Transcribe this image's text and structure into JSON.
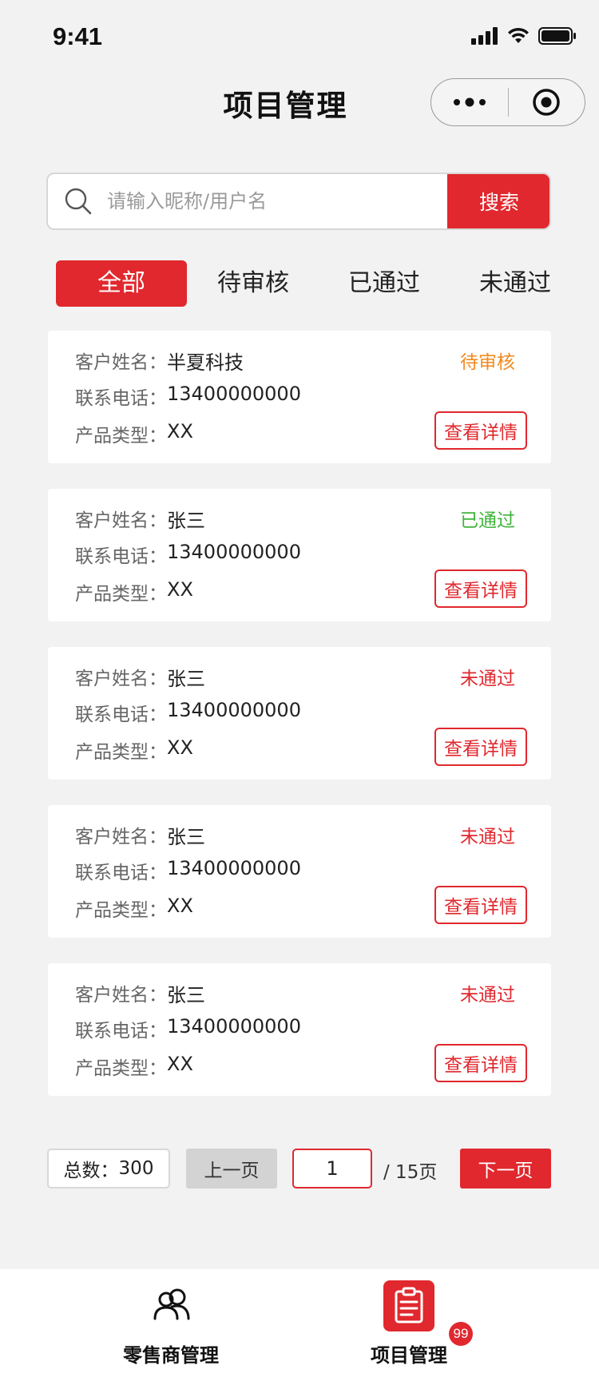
{
  "status_bar": {
    "time": "9:41"
  },
  "nav": {
    "title": "项目管理"
  },
  "search": {
    "placeholder": "请输入昵称/用户名",
    "value": "",
    "button_label": "搜索"
  },
  "tabs": [
    {
      "label": "全部",
      "active": true
    },
    {
      "label": "待审核",
      "active": false
    },
    {
      "label": "已通过",
      "active": false
    },
    {
      "label": "未通过",
      "active": false
    }
  ],
  "field_labels": {
    "name": "客户姓名：",
    "phone": "联系电话：",
    "type": "产品类型："
  },
  "detail_label": "查看详情",
  "records": [
    {
      "name": "半夏科技",
      "phone": "13400000000",
      "type": "XX",
      "status": "待审核",
      "status_color": "#f28a20"
    },
    {
      "name": "张三",
      "phone": "13400000000",
      "type": "XX",
      "status": "已通过",
      "status_color": "#3fb43a"
    },
    {
      "name": "张三",
      "phone": "13400000000",
      "type": "XX",
      "status": "未通过",
      "status_color": "#e0282e"
    },
    {
      "name": "张三",
      "phone": "13400000000",
      "type": "XX",
      "status": "未通过",
      "status_color": "#e0282e"
    },
    {
      "name": "张三",
      "phone": "13400000000",
      "type": "XX",
      "status": "未通过",
      "status_color": "#e0282e"
    }
  ],
  "pagination": {
    "total_label": "总数：",
    "total": "300",
    "prev_label": "上一页",
    "current_page": "1",
    "page_total": "/ 15页",
    "next_label": "下一页"
  },
  "tabbar": {
    "items": [
      {
        "label": "零售商管理",
        "icon": "users-icon",
        "active": false
      },
      {
        "label": "项目管理",
        "icon": "clipboard-icon",
        "active": true
      }
    ],
    "badge_count": "99"
  },
  "colors": {
    "accent": "#e0282e",
    "background": "#f2f2f3"
  }
}
